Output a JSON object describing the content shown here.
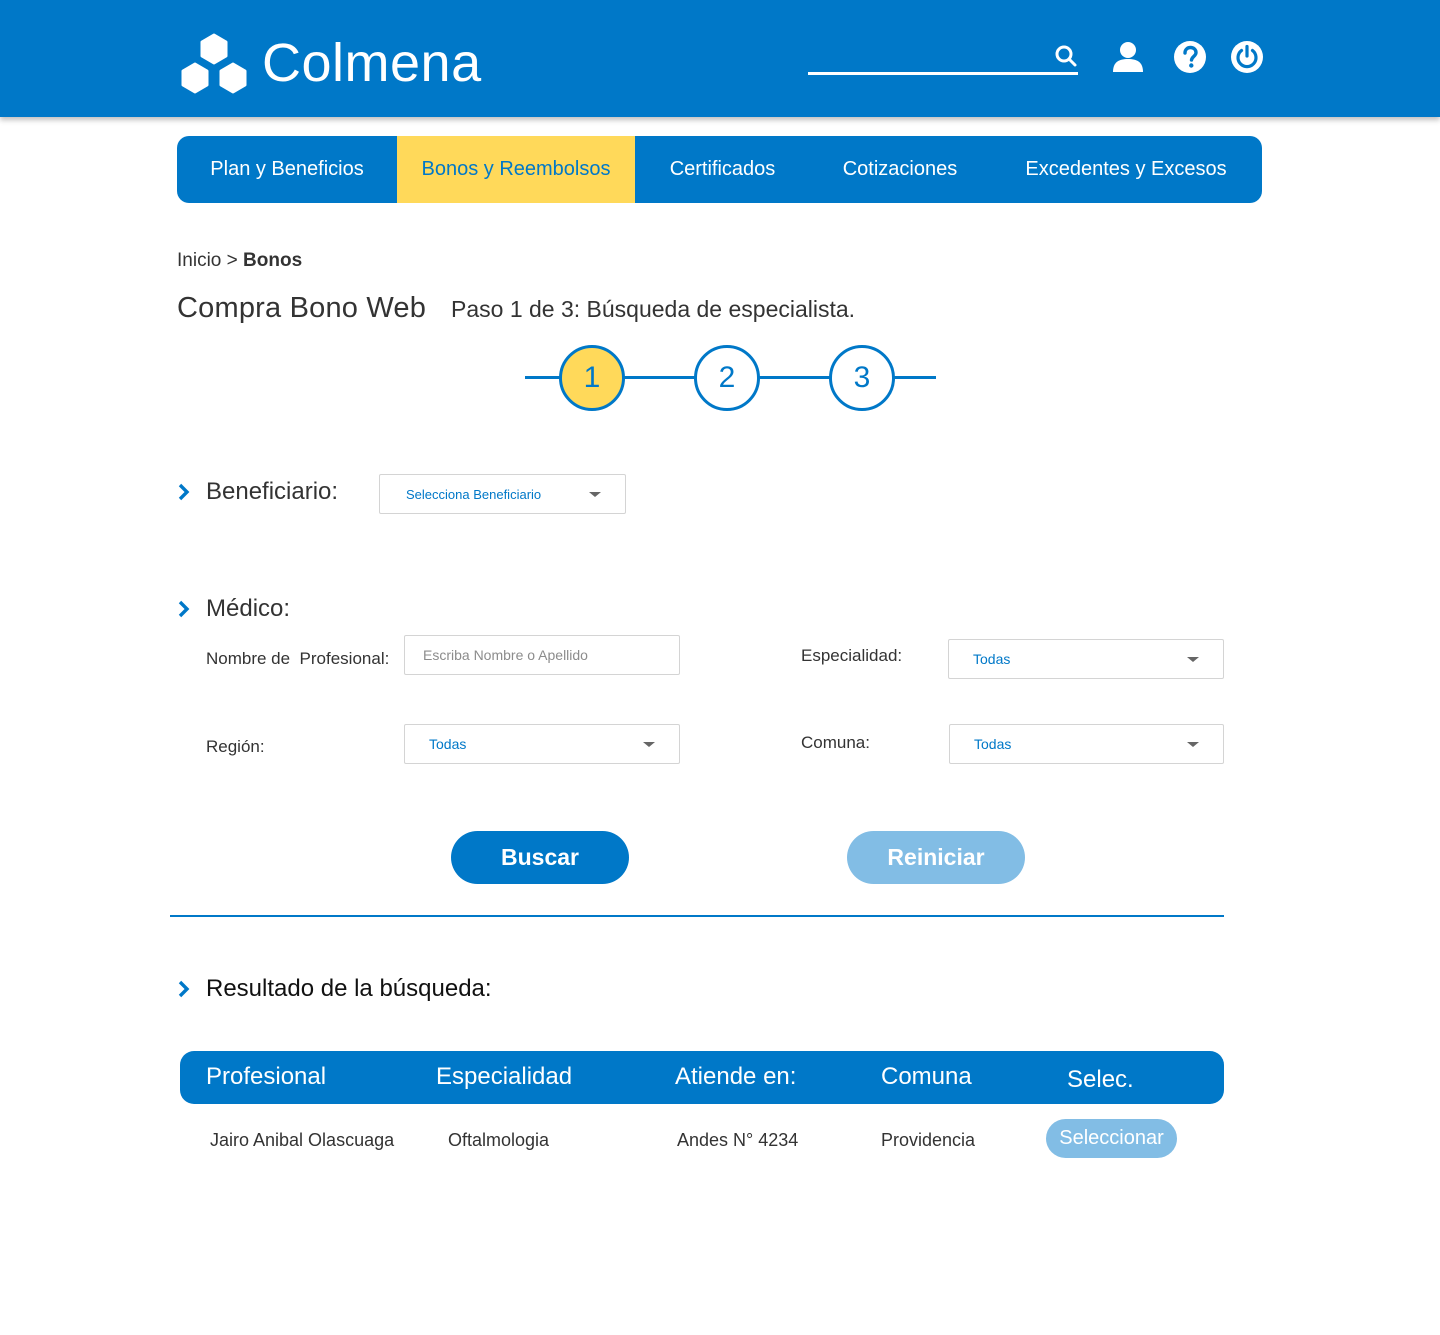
{
  "header": {
    "brand": "Colmena",
    "search": {
      "value": "",
      "placeholder": ""
    },
    "icons": [
      "search-icon",
      "user-icon",
      "help-icon",
      "power-icon"
    ]
  },
  "nav": {
    "items": [
      {
        "label": "Plan y Beneficios",
        "active": false
      },
      {
        "label": "Bonos y Reembolsos",
        "active": true
      },
      {
        "label": "Certificados",
        "active": false
      },
      {
        "label": "Cotizaciones",
        "active": false
      },
      {
        "label": "Excedentes y Excesos",
        "active": false
      }
    ]
  },
  "breadcrumb": {
    "home": "Inicio",
    "separator": ">",
    "current": "Bonos"
  },
  "page": {
    "title": "Compra Bono Web",
    "step_caption": "Paso 1 de 3: Búsqueda de especialista."
  },
  "stepper": {
    "steps": [
      "1",
      "2",
      "3"
    ],
    "current": 1
  },
  "beneficiario": {
    "label": "Beneficiario:",
    "select_value": "Selecciona Beneficiario"
  },
  "medico": {
    "label": "Médico:",
    "nombre_label": "Nombre de  Profesional:",
    "nombre_placeholder": "Escriba Nombre o Apellido",
    "nombre_value": "",
    "especialidad_label": "Especialidad:",
    "especialidad_value": "Todas",
    "region_label": "Región:",
    "region_value": "Todas",
    "comuna_label": "Comuna:",
    "comuna_value": "Todas"
  },
  "actions": {
    "search": "Buscar",
    "reset": "Reiniciar"
  },
  "results": {
    "label": "Resultado de la búsqueda:",
    "columns": [
      "Profesional",
      "Especialidad",
      "Atiende en:",
      "Comuna",
      "Selec."
    ],
    "rows": [
      {
        "profesional": "Jairo Anibal Olascuaga",
        "especialidad": "Oftalmologia",
        "atiende_en": "Andes N° 4234",
        "comuna": "Providencia",
        "action": "Seleccionar"
      }
    ]
  },
  "colors": {
    "primary": "#0078c8",
    "accent": "#ffd95a",
    "disabled": "#82bde5"
  }
}
